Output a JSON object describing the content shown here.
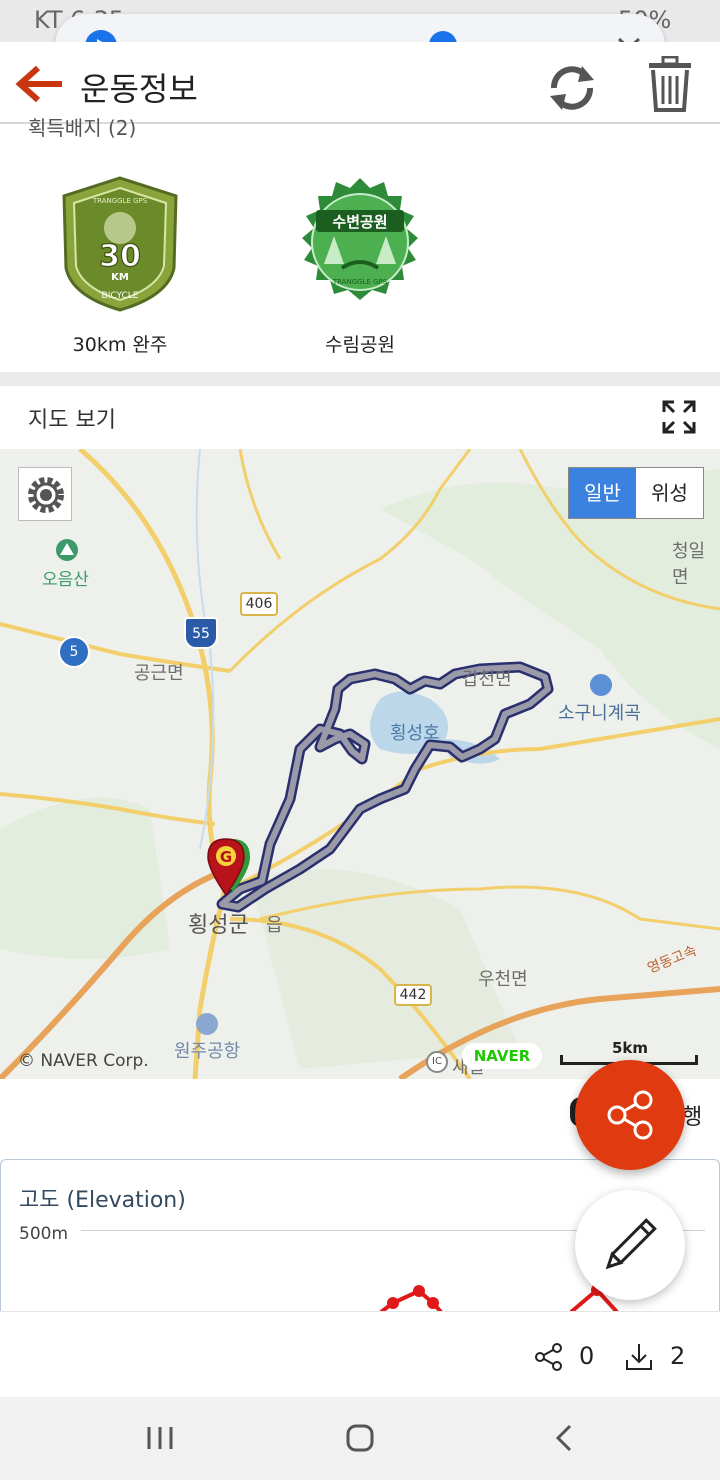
{
  "status_bar": {
    "carrier_time": "KT 6:35",
    "battery": "50%"
  },
  "media": {
    "progress": 0.69
  },
  "header": {
    "title": "운동정보"
  },
  "badges": {
    "section_title": "획득배지 (2)",
    "items": [
      {
        "label": "30km 완주",
        "badge_text_top": "TRANGGLE GPS",
        "badge_value": "30",
        "badge_unit": "KM",
        "badge_text_bottom": "BICYCLE"
      },
      {
        "label": "수림공원",
        "badge_text_top": "수변공원",
        "badge_text_bottom": "TRANGGLE GPS"
      }
    ]
  },
  "map_section": {
    "title": "지도 보기",
    "map_type": {
      "normal": "일반",
      "satellite": "위성",
      "selected": "일반"
    },
    "labels": {
      "mountain": "오음산",
      "gonggeun": "공근면",
      "hoengseong_lake": "횡성호",
      "gapcheon": "갑천면",
      "sogu": "소구니계곡",
      "cheongil": "청일면",
      "hoengseong": "횡성군",
      "eup": "읍",
      "ucheon": "우천면",
      "airport": "원주공항",
      "expressway": "영동고속",
      "ic": "IC",
      "ic_name": "새말"
    },
    "road_numbers": {
      "r406": "406",
      "r55": "55",
      "r5": "5",
      "r442": "442"
    },
    "marker": "G",
    "copyright": "© NAVER Corp.",
    "naver": "NAVER",
    "scale": "5km"
  },
  "below_map": {
    "partial_text": "행"
  },
  "elevation": {
    "title": "고도 (Elevation)",
    "y_label": "500m"
  },
  "stats": {
    "shares": "0",
    "downloads": "2"
  },
  "colors": {
    "accent": "#e03a11",
    "selected_toggle": "#3b82e0",
    "route": "#2a2f6e"
  }
}
